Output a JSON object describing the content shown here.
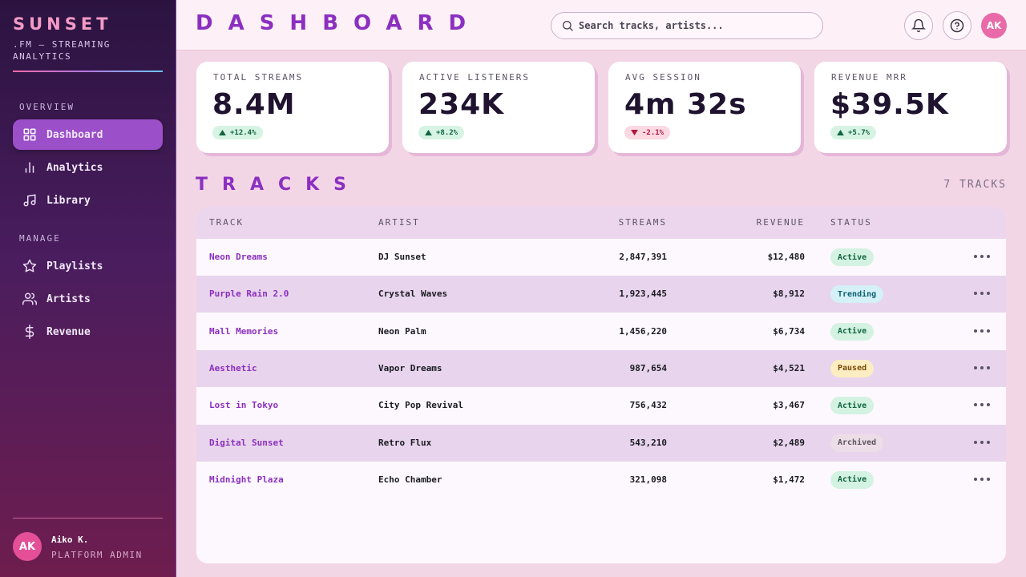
{
  "sidebar": {
    "brand": "SUNSET",
    "subtitle": ".FM — STREAMING ANALYTICS",
    "sections": {
      "overview": "OVERVIEW",
      "manage": "MANAGE"
    },
    "items": [
      {
        "label": "Dashboard",
        "icon": "grid-icon",
        "active": true
      },
      {
        "label": "Analytics",
        "icon": "bar-chart-icon"
      },
      {
        "label": "Library",
        "icon": "music-note-icon"
      },
      {
        "label": "Playlists",
        "icon": "star-icon"
      },
      {
        "label": "Artists",
        "icon": "users-icon"
      },
      {
        "label": "Revenue",
        "icon": "dollar-icon"
      }
    ],
    "user": {
      "initials": "AK",
      "name": "Aiko K.",
      "role": "PLATFORM ADMIN"
    }
  },
  "header": {
    "title": "DASHBOARD",
    "search_placeholder": "Search tracks, artists...",
    "avatar_initials": "AK"
  },
  "kpis": [
    {
      "label": "TOTAL STREAMS",
      "value": "8.4M",
      "delta": "+12.4%",
      "direction": "up"
    },
    {
      "label": "ACTIVE LISTENERS",
      "value": "234K",
      "delta": "+8.2%",
      "direction": "up"
    },
    {
      "label": "AVG SESSION",
      "value": "4m 32s",
      "delta": "-2.1%",
      "direction": "down"
    },
    {
      "label": "REVENUE MRR",
      "value": "$39.5K",
      "delta": "+5.7%",
      "direction": "up"
    }
  ],
  "tracks": {
    "title": "TRACKS",
    "count_label": "7 TRACKS",
    "columns": [
      "TRACK",
      "ARTIST",
      "STREAMS",
      "REVENUE",
      "STATUS"
    ],
    "rows": [
      {
        "track": "Neon Dreams",
        "artist": "DJ Sunset",
        "streams": "2,847,391",
        "revenue": "$12,480",
        "status": "Active"
      },
      {
        "track": "Purple Rain 2.0",
        "artist": "Crystal Waves",
        "streams": "1,923,445",
        "revenue": "$8,912",
        "status": "Trending"
      },
      {
        "track": "Mall Memories",
        "artist": "Neon Palm",
        "streams": "1,456,220",
        "revenue": "$6,734",
        "status": "Active"
      },
      {
        "track": "Aesthetic",
        "artist": "Vapor Dreams",
        "streams": "987,654",
        "revenue": "$4,521",
        "status": "Paused"
      },
      {
        "track": "Lost in Tokyo",
        "artist": "City Pop Revival",
        "streams": "756,432",
        "revenue": "$3,467",
        "status": "Active"
      },
      {
        "track": "Digital Sunset",
        "artist": "Retro Flux",
        "streams": "543,210",
        "revenue": "$2,489",
        "status": "Archived"
      },
      {
        "track": "Midnight Plaza",
        "artist": "Echo Chamber",
        "streams": "321,098",
        "revenue": "$1,472",
        "status": "Active"
      }
    ]
  },
  "status_colors": {
    "Active": {
      "bg": "#d3f2e1",
      "fg": "#11653f"
    },
    "Trending": {
      "bg": "#d3f1f7",
      "fg": "#0e5f73"
    },
    "Paused": {
      "bg": "#fcedc2",
      "fg": "#7a4a08"
    },
    "Archived": {
      "bg": "#eddde6",
      "fg": "#5c5560"
    }
  },
  "colors": {
    "accent": "#8b2fc0",
    "brand_pink": "#f39ac6"
  }
}
